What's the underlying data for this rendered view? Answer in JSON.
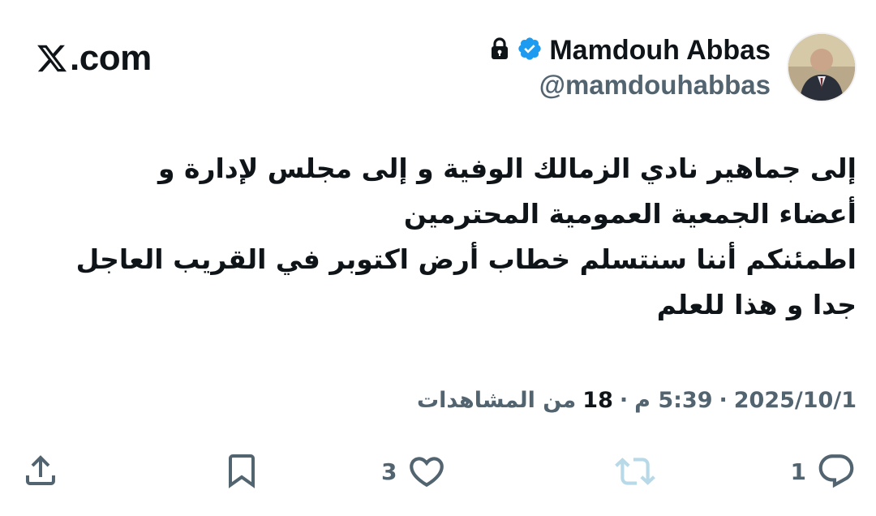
{
  "brand": {
    "site": ".com",
    "logo_icon": "x-logo-icon"
  },
  "author": {
    "name": "Mamdouh Abbas",
    "handle": "@mamdouhabbas",
    "verified_icon": "verified-badge-icon",
    "protected_icon": "lock-icon",
    "verified_color": "#1d9bf0"
  },
  "tweet": {
    "lines": [
      "إلى جماهير نادي الزمالك الوفية و إلى مجلس لإدارة و",
      "أعضاء الجمعية العمومية المحترمين",
      "اطمئنكم أننا سنتسلم خطاب أرض اكتوبر في القريب العاجل",
      "جدا و هذا  للعلم"
    ]
  },
  "meta": {
    "date": "2025/10/1",
    "separator": "·",
    "time": "5:39 م",
    "views_count": "18",
    "views_label": "من المشاهدات"
  },
  "actions": {
    "reply_count": "1",
    "retweet_count": "",
    "like_count": "3",
    "icons": [
      "reply-icon",
      "retweet-icon",
      "like-icon",
      "bookmark-icon",
      "share-icon"
    ]
  },
  "colors": {
    "text": "#0f1419",
    "secondary": "#536471",
    "retweet_disabled": "#b8d9e8"
  }
}
